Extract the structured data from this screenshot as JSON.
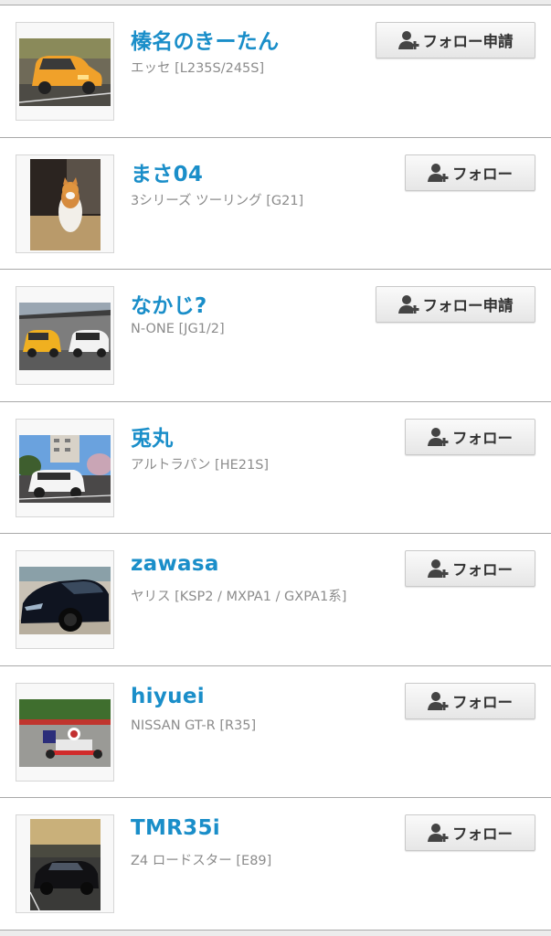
{
  "users": [
    {
      "name": "榛名のきーたん",
      "car": "エッセ [L235S/245S]",
      "button": "フォロー申請"
    },
    {
      "name": "まさ04",
      "car": "3シリーズ ツーリング [G21]",
      "button": "フォロー"
    },
    {
      "name": "なかじ?",
      "car": "N-ONE [JG1/2]",
      "button": "フォロー申請"
    },
    {
      "name": "兎丸",
      "car": "アルトラパン [HE21S]",
      "button": "フォロー"
    },
    {
      "name": "zawasa",
      "car": "ヤリス [KSP2 / MXPA1 / GXPA1系]",
      "button": "フォロー"
    },
    {
      "name": "hiyuei",
      "car": "NISSAN GT-R [R35]",
      "button": "フォロー"
    },
    {
      "name": "TMR35i",
      "car": "Z4 ロードスター [E89]",
      "button": "フォロー"
    }
  ],
  "icons": {
    "follow_button_icon": "add-user-icon"
  },
  "colors": {
    "username": "#1a8ec9",
    "car_model": "#8c8c8c",
    "divider": "#a9a9a9"
  }
}
